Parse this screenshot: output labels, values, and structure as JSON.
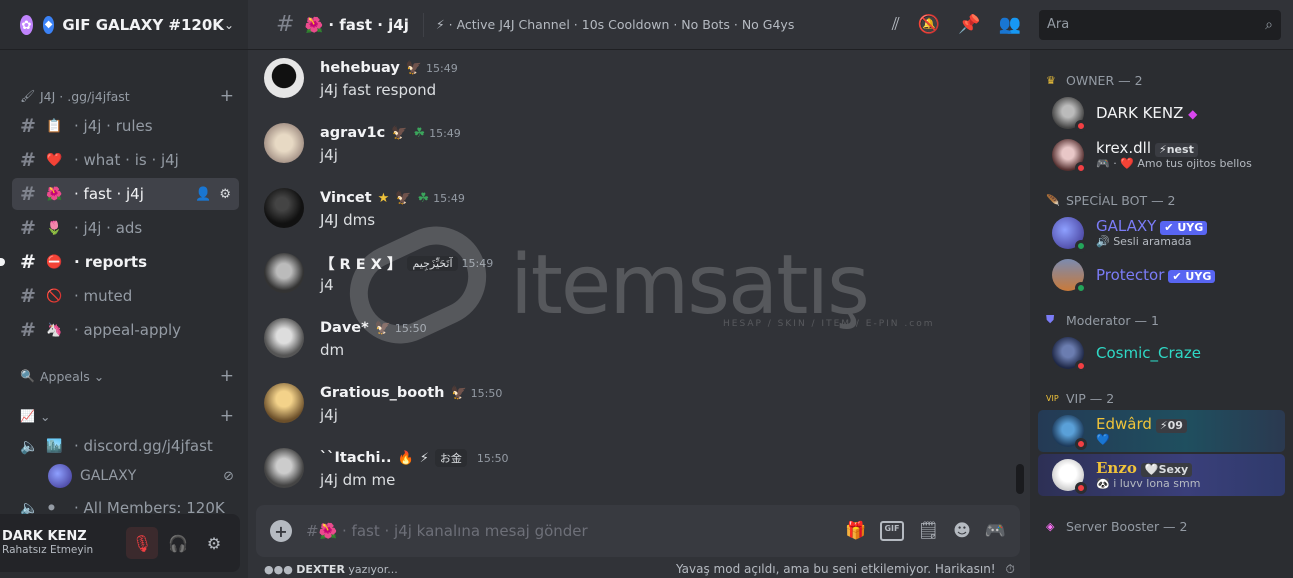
{
  "server": {
    "name": "GIF GALAXY #120K"
  },
  "sidebar": {
    "category_j4j": "J4J · .gg/j4jfast",
    "channels": [
      {
        "emoji": "📋",
        "name": "· j4j · rules"
      },
      {
        "emoji": "❤️",
        "name": "· what · is · j4j"
      },
      {
        "emoji": "🌺",
        "name": "· fast · j4j"
      },
      {
        "emoji": "🌷",
        "name": "· j4j · ads"
      },
      {
        "emoji": "⛔",
        "name": "· reports"
      },
      {
        "emoji": "🚫",
        "name": "· muted"
      },
      {
        "emoji": "🦄",
        "name": "· appeal-apply"
      }
    ],
    "category_appeals": "Appeals",
    "category_stats": "",
    "voice_channels": [
      {
        "emoji": "🏙️",
        "name": "· discord.gg/j4jfast"
      },
      {
        "emoji": "⚫",
        "name": "· All Members: 120K"
      }
    ],
    "voice_member": "GALAXY"
  },
  "user_panel": {
    "name": "DARK KENZ",
    "status": "Rahatsız Etmeyin"
  },
  "header": {
    "channel_title": "🌺 · fast · j4j",
    "topic": "⚡ · Active J4J Channel · 10s Cooldown · No Bots · No G4ys",
    "search_placeholder": "Ara"
  },
  "messages": [
    {
      "author": "hehebuay",
      "time": "15:49",
      "text": "j4j fast respond",
      "color": "#f2f3f5"
    },
    {
      "author": "agrav1c",
      "time": "15:49",
      "text": "j4j",
      "color": "#f2f3f5"
    },
    {
      "author": "Vincet",
      "time": "15:49",
      "text": "J4J dms",
      "color": "#f2f3f5"
    },
    {
      "author": "【 R E X 】",
      "time": "15:49",
      "text": "j4",
      "color": "#f2f3f5",
      "tag": "آتَحَيِّزَجِيم"
    },
    {
      "author": "Dave*",
      "time": "15:50",
      "text": "dm",
      "color": "#f2f3f5"
    },
    {
      "author": "Gratious_booth",
      "time": "15:50",
      "text": "j4j",
      "color": "#f2f3f5"
    },
    {
      "author": "``Itachi..",
      "time": "15:50",
      "text": "j4j dm me",
      "color": "#f2f3f5",
      "tag": "お金"
    }
  ],
  "composer": {
    "placeholder": "#🌺 · fast · j4j kanalına mesaj gönder"
  },
  "typing": {
    "user": "DEXTER",
    "suffix": "yazıyor..."
  },
  "slowmode_text": "Yavaş mod açıldı, ama bu seni etkilemiyor. Harikasın!",
  "members": {
    "groups": [
      {
        "label": "OWNER — 2"
      },
      {
        "label": "SPECİAL BOT — 2"
      },
      {
        "label": "Moderator — 1"
      },
      {
        "label": "VIP — 2"
      },
      {
        "label": "Server Booster — 2"
      }
    ],
    "list": [
      {
        "name": "DARK KENZ",
        "sub": "",
        "color": "#f2f3f5"
      },
      {
        "name": "krex.dll",
        "sub": "🎮 · ❤️ Amo tus ojitos bellos",
        "tag": "⚡nest",
        "color": "#f2f3f5"
      },
      {
        "name": "GALAXY",
        "sub": "🔊 Sesli aramada",
        "badge": "✔ UYG",
        "color": "#7b7cf7"
      },
      {
        "name": "Protector",
        "sub": "",
        "badge": "✔ UYG",
        "color": "#7b7cf7"
      },
      {
        "name": "Cosmic_Craze",
        "sub": "",
        "color": "#2fd9c6"
      },
      {
        "name": "Edwârd",
        "sub": "💙",
        "tag": "⚡09",
        "color": "#f0c33a"
      },
      {
        "name": "Enzo",
        "sub": "🐼 i luvv lona smm",
        "tag": "🤍Sexy",
        "color": "#f0c33a"
      }
    ]
  },
  "watermark": {
    "text": "itemsatış",
    "sub": "HESAP / SKIN / ITEM / E-PIN .com"
  }
}
